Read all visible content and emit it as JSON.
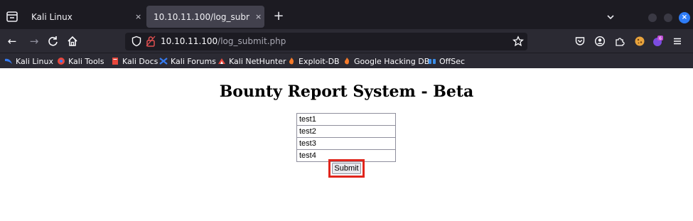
{
  "browser": {
    "tabs": [
      {
        "label": "Kali Linux",
        "active": false
      },
      {
        "label": "10.10.11.100/log_submit.php",
        "active": true
      }
    ],
    "close_glyph": "×",
    "new_tab_glyph": "+",
    "window_close_glyph": "×",
    "url": {
      "host": "10.10.11.100",
      "path": "/log_submit.php"
    },
    "bookmarks": [
      {
        "label": "Kali Linux",
        "icon": "kali-dragon-icon",
        "color": "#367bf0"
      },
      {
        "label": "Kali Tools",
        "icon": "kali-tools-icon",
        "color": "#e7473c"
      },
      {
        "label": "Kali Docs",
        "icon": "kali-docs-icon",
        "color": "#e7473c"
      },
      {
        "label": "Kali Forums",
        "icon": "kali-forums-icon",
        "color": "#367bf0"
      },
      {
        "label": "Kali NetHunter",
        "icon": "nethunter-icon",
        "color": "#e7473c"
      },
      {
        "label": "Exploit-DB",
        "icon": "exploit-db-icon",
        "color": "#f47a2a"
      },
      {
        "label": "Google Hacking DB",
        "icon": "ghdb-icon",
        "color": "#f47a2a"
      },
      {
        "label": "OffSec",
        "icon": "offsec-icon",
        "color": "#3b8ee8"
      }
    ]
  },
  "page": {
    "title": "Bounty Report System - Beta",
    "fields": [
      {
        "value": "test1"
      },
      {
        "value": "test2"
      },
      {
        "value": "test3"
      },
      {
        "value": "test4"
      }
    ],
    "submit_label": "Submit",
    "highlight_color": "#e0251c"
  }
}
